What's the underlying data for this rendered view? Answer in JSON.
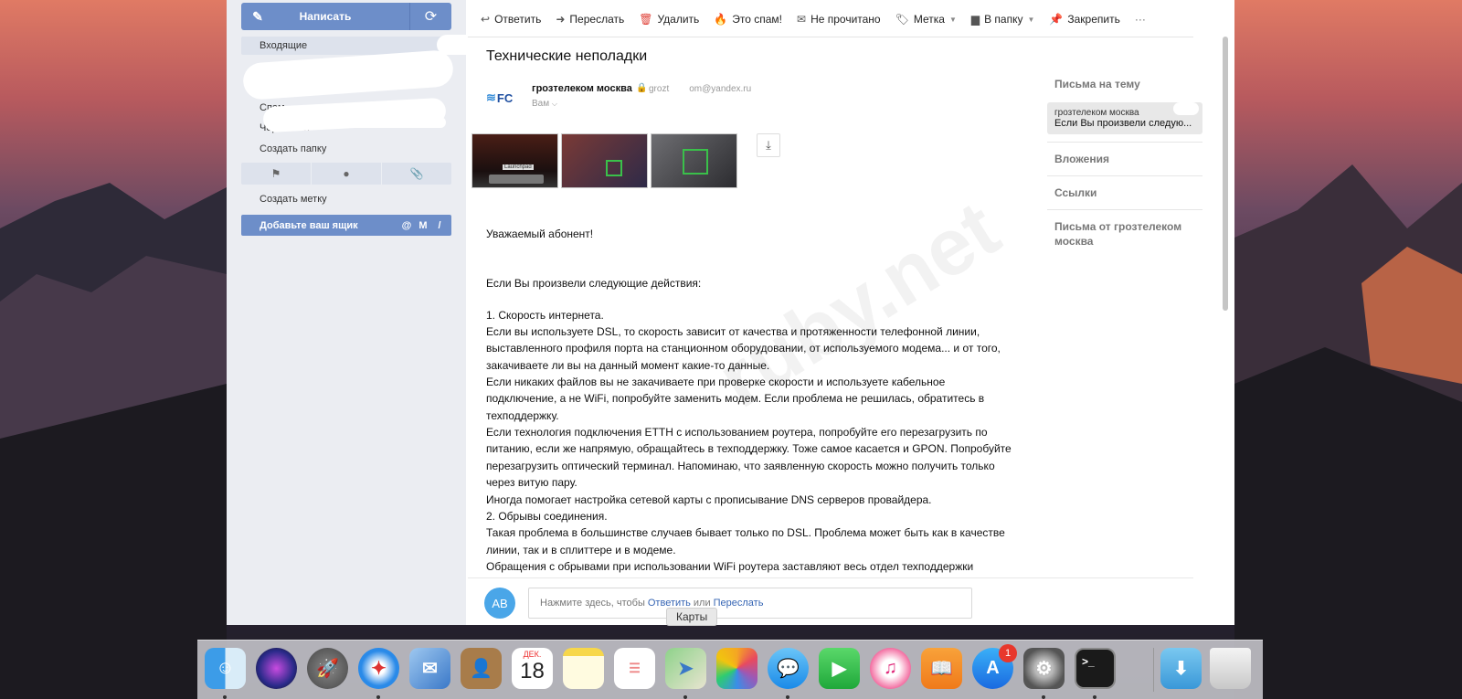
{
  "sidebar": {
    "compose_label": "Написать",
    "folders": {
      "inbox": "Входящие",
      "spam": "Спам",
      "drafts": "Черновики",
      "create_folder": "Создать папку"
    },
    "create_label": "Создать метку",
    "add_mailbox": "Добавьте ваш ящик"
  },
  "toolbar": {
    "reply": "Ответить",
    "forward": "Переслать",
    "delete": "Удалить",
    "spam": "Это спам!",
    "unread": "Не прочитано",
    "label": "Метка",
    "to_folder": "В папку",
    "pin": "Закрепить",
    "more": "···"
  },
  "message": {
    "subject": "Технические неполадки",
    "sender_logo": "FC",
    "sender_name": "грозтелеком москва",
    "sender_email_start": "grozt",
    "sender_email_end": "om@yandex.ru",
    "recipient": "Вам",
    "greeting": "Уважаемый абонент!",
    "intro": "Если Вы произвели следующие действия:",
    "body_lines": [
      "1. Скорость интернета.",
      "Если вы используете DSL, то скорость зависит от качества и протяженности телефонной линии,",
      "выставленного профиля порта на станционном оборудовании, от используемого модема... и от того,",
      "закачиваете ли вы на данный момент какие-то данные.",
      "Если никаких файлов вы не закачиваете при проверке скорости и используете кабельное",
      "подключение, а не WiFi, попробуйте заменить модем. Если проблема не решилась, обратитесь в",
      "техподдержку.",
      "Если технология подключения ETTH с использованием роутера, попробуйте его перезагрузить по",
      "питанию, если же напрямую, обращайтесь в техподдержку. Тоже самое касается и GPON. Попробуйте",
      "перезагрузить оптический терминал. Напоминаю, что заявленную скорость можно получить только",
      "через витую пару.",
      "Иногда помогает настройка сетевой карты с прописывание DNS серверов провайдера.",
      "2. Обрывы соединения.",
      "Такая проблема в большинстве случаев бывает только по DSL. Проблема может быть как в качестве",
      "линии, так и в сплиттере и в модеме.",
      "Обращения с обрывами при использовании WiFi роутера заставляют весь отдел техподдержки"
    ],
    "thumb_caption": "Launchpad",
    "watermark": "ruby.net"
  },
  "right_panel": {
    "thread_title": "Письма на тему",
    "thread_sender": "грозтелеком москва",
    "thread_preview": "Если Вы произвели следую...",
    "attachments": "Вложения",
    "links": "Ссылки",
    "from_sender": "Письма от грозтелеком москва"
  },
  "reply": {
    "avatar": "AB",
    "prefix": "Нажмите здесь, чтобы",
    "reply_link": "Ответить",
    "or": "или",
    "forward_link": "Переслать"
  },
  "dock": {
    "tooltip": "Карты",
    "calendar_month": "ДЕК.",
    "calendar_day": "18",
    "appstore_badge": "1"
  },
  "colors": {
    "accent": "#6d8ec9",
    "avatar": "#4aa6e8",
    "link": "#3665b4",
    "spam_icon": "#f08a1c",
    "delete_icon": "#e0443b"
  }
}
